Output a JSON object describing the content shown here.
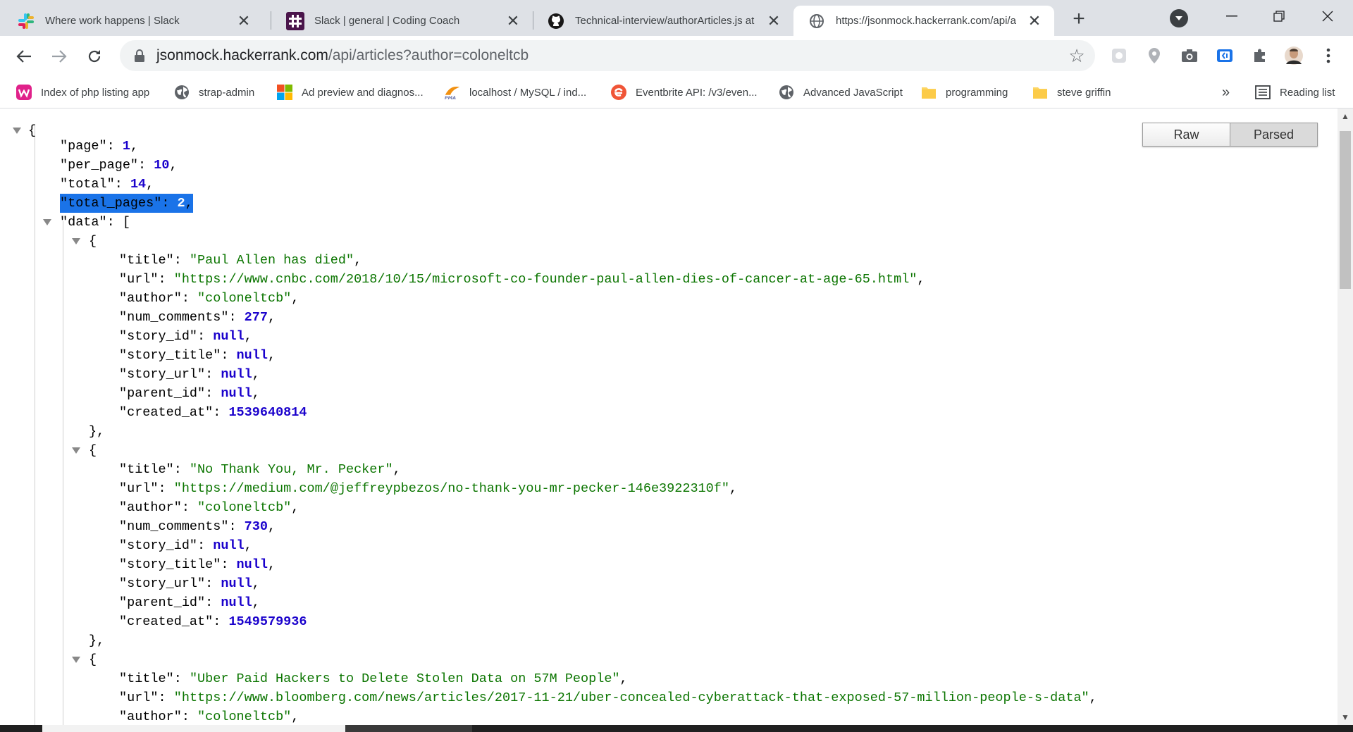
{
  "tabs": [
    {
      "title": "Where work happens | Slack",
      "icon": "slack-icon"
    },
    {
      "title": "Slack | general | Coding Coach",
      "icon": "slack-workspace-icon"
    },
    {
      "title": "Technical-interview/authorArticles.js at",
      "icon": "github-icon"
    },
    {
      "title": "https://jsonmock.hackerrank.com/api/a",
      "icon": "globe-icon"
    }
  ],
  "toolbar": {
    "url_host": "jsonmock.hackerrank.com",
    "url_path": "/api/articles?author=coloneltcb"
  },
  "bookmarks": [
    {
      "label": "Index of php listing app",
      "icon": "wamp-icon"
    },
    {
      "label": "strap-admin",
      "icon": "globe-icon"
    },
    {
      "label": "Ad preview and diagnos...",
      "icon": "microsoft-icon"
    },
    {
      "label": "localhost / MySQL / ind...",
      "icon": "phpmyadmin-icon"
    },
    {
      "label": "Eventbrite API: /v3/even...",
      "icon": "eventbrite-icon"
    },
    {
      "label": "Advanced JavaScript",
      "icon": "globe-icon"
    },
    {
      "label": "programming",
      "icon": "folder-icon"
    },
    {
      "label": "steve griffin",
      "icon": "folder-icon"
    }
  ],
  "bookmarks_overflow": "»",
  "reading_list": "Reading list",
  "viewer": {
    "raw_label": "Raw",
    "parsed_label": "Parsed",
    "active_mode": "Parsed"
  },
  "json": {
    "page": "1",
    "per_page": "10",
    "total": "14",
    "total_pages": "2",
    "data": [
      {
        "title": "\"Paul Allen has died\"",
        "url": "\"https://www.cnbc.com/2018/10/15/microsoft-co-founder-paul-allen-dies-of-cancer-at-age-65.html\"",
        "author": "\"coloneltcb\"",
        "num_comments": "277",
        "story_id": "null",
        "story_title": "null",
        "story_url": "null",
        "parent_id": "null",
        "created_at": "1539640814"
      },
      {
        "title": "\"No Thank You, Mr. Pecker\"",
        "url": "\"https://medium.com/@jeffreypbezos/no-thank-you-mr-pecker-146e3922310f\"",
        "author": "\"coloneltcb\"",
        "num_comments": "730",
        "story_id": "null",
        "story_title": "null",
        "story_url": "null",
        "parent_id": "null",
        "created_at": "1549579936"
      },
      {
        "title": "\"Uber Paid Hackers to Delete Stolen Data on 57M People\"",
        "url": "\"https://www.bloomberg.com/news/articles/2017-11-21/uber-concealed-cyberattack-that-exposed-57-million-people-s-data\"",
        "author": "\"coloneltcb\""
      }
    ]
  }
}
